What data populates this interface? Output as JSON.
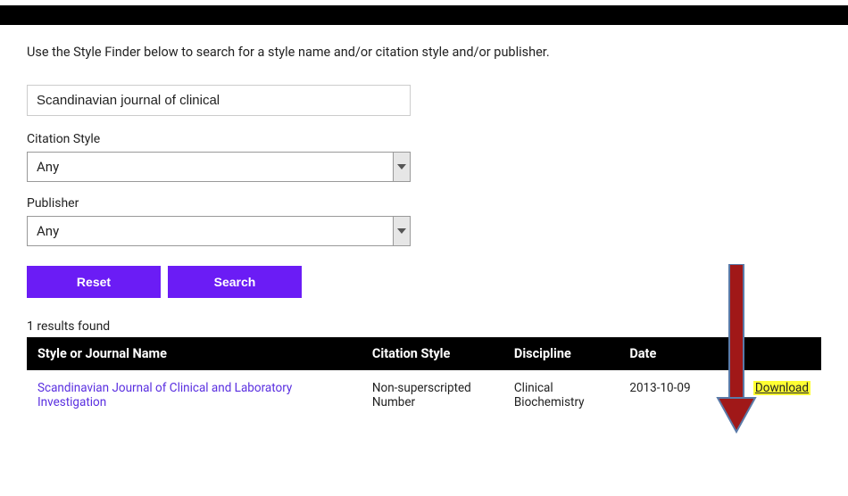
{
  "instructions": "Use the Style Finder below to search for a style name and/or citation style and/or publisher.",
  "search": {
    "value": "Scandinavian journal of clinical"
  },
  "citation_style": {
    "label": "Citation Style",
    "selected": "Any"
  },
  "publisher": {
    "label": "Publisher",
    "selected": "Any"
  },
  "buttons": {
    "reset": "Reset",
    "search": "Search"
  },
  "results": {
    "count_text": "1 results found",
    "headers": {
      "name": "Style or Journal Name",
      "citation": "Citation Style",
      "discipline": "Discipline",
      "date": "Date",
      "download": ""
    },
    "rows": [
      {
        "name": "Scandinavian Journal of Clinical and Laboratory Investigation",
        "citation": "Non-superscripted Number",
        "discipline": "Clinical Biochemistry",
        "date": "2013-10-09",
        "download": "Download"
      }
    ]
  }
}
